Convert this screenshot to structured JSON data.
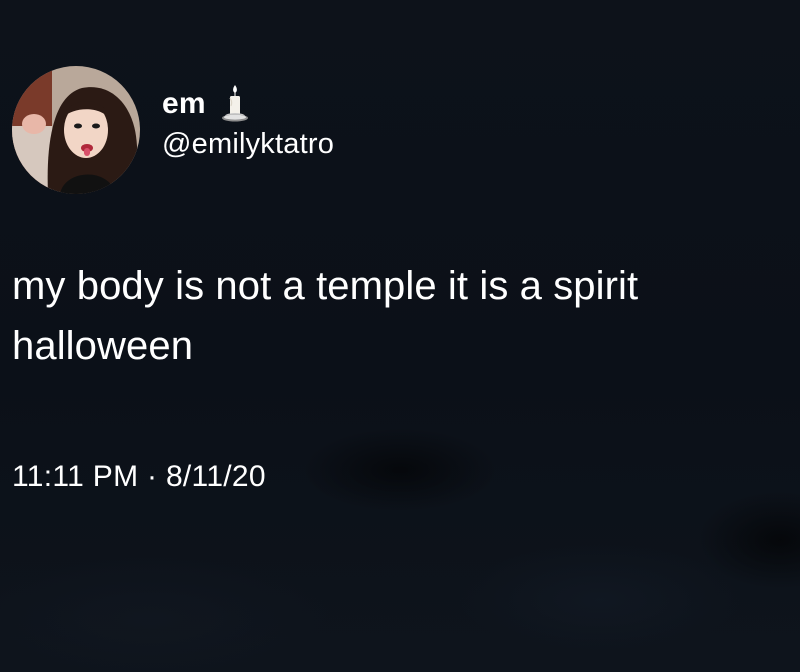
{
  "tweet": {
    "display_name": "em",
    "name_emoji_icon": "candle-icon",
    "handle": "@emilyktatro",
    "text_lines": [
      "my body is not a temple it is a spirit",
      "halloween"
    ],
    "time": "11:11 PM",
    "separator": "·",
    "date": "8/11/20"
  },
  "colors": {
    "background": "#0c1119",
    "text": "#ffffff"
  }
}
